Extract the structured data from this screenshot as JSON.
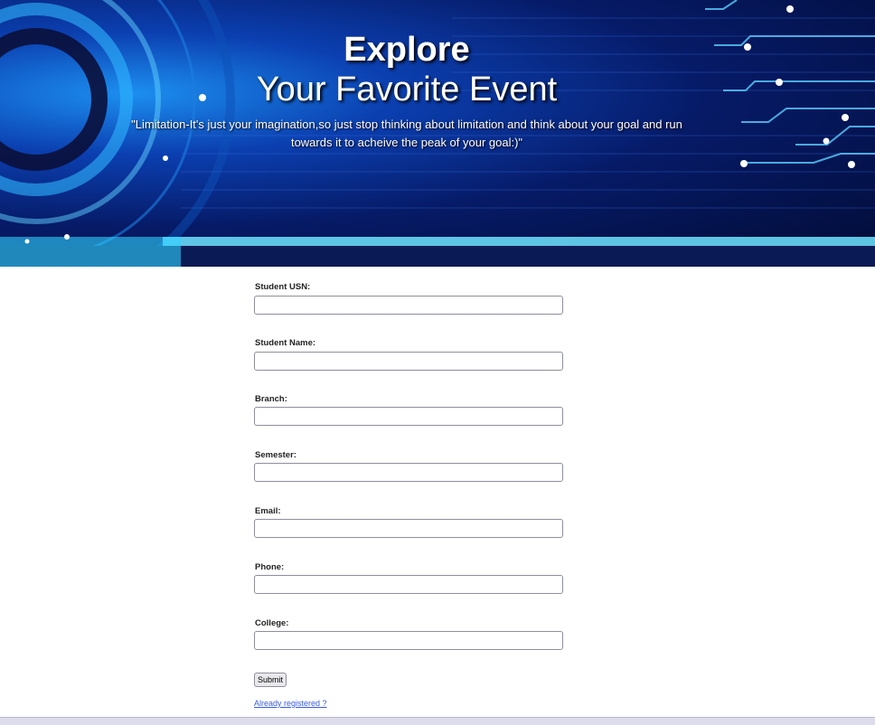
{
  "hero": {
    "title": "Explore",
    "subtitle": "Your Favorite Event",
    "quote": "\"Limitation-It's just your imagination,so just stop thinking about limitation and think about your goal and run towards it to acheive the peak of your goal:)\""
  },
  "form": {
    "fields": [
      {
        "label": "Student USN:",
        "value": ""
      },
      {
        "label": "Student Name:",
        "value": ""
      },
      {
        "label": "Branch:",
        "value": ""
      },
      {
        "label": "Semester:",
        "value": ""
      },
      {
        "label": "Email:",
        "value": ""
      },
      {
        "label": "Phone:",
        "value": ""
      },
      {
        "label": "College:",
        "value": ""
      }
    ],
    "submit_label": "Submit",
    "already_registered_link": "Already registered ?"
  },
  "colors": {
    "hero_dark": "#020b33",
    "hero_glow": "#1c8ff0",
    "link": "#3b5bdb"
  }
}
